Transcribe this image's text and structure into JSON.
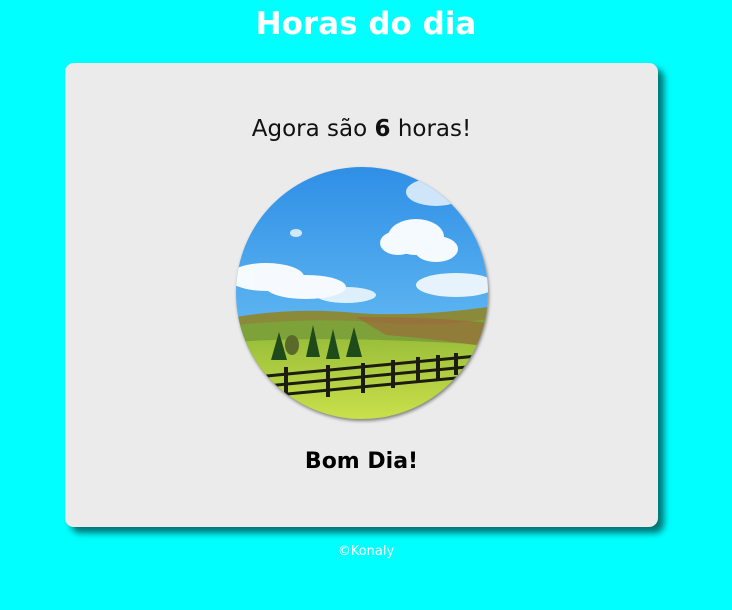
{
  "header": {
    "title": "Horas do dia"
  },
  "message": {
    "prefix": "Agora são ",
    "hour": "6",
    "suffix": " horas!"
  },
  "image": {
    "name": "morning-landscape"
  },
  "greeting": {
    "text": "Bom Dia!"
  },
  "footer": {
    "text": "©Konaly"
  },
  "colors": {
    "background": "#00ffff",
    "card": "#ebebeb",
    "title": "#ffffff"
  }
}
